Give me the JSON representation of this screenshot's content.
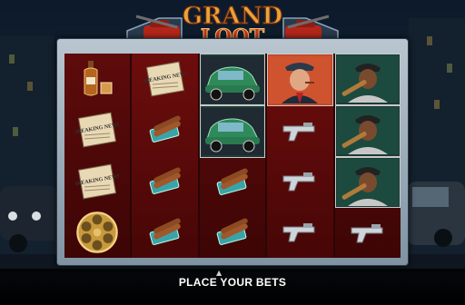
{
  "game": {
    "logo_text_line1": "GRAND",
    "logo_text_line2": "LOOT",
    "status_message": "PLACE YOUR BETS",
    "reels": [
      [
        "whiskey",
        "newspaper",
        "newspaper",
        "revolver-cylinder"
      ],
      [
        "newspaper",
        "cigars",
        "cigars",
        "cigars"
      ],
      [
        "vintage-car",
        "vintage-car",
        "cigars",
        "cigars"
      ],
      [
        "mob-boss",
        "pistol",
        "pistol",
        "pistol"
      ],
      [
        "gangster-bat",
        "gangster-bat",
        "gangster-bat",
        "pistol"
      ]
    ],
    "newspaper_text": "BREAKING NEWS",
    "colors": {
      "logo_gold": "#e8a33a",
      "logo_red": "#c4351e",
      "reel_red": "#5e0b0b",
      "frame": "#9fb0bd"
    }
  }
}
